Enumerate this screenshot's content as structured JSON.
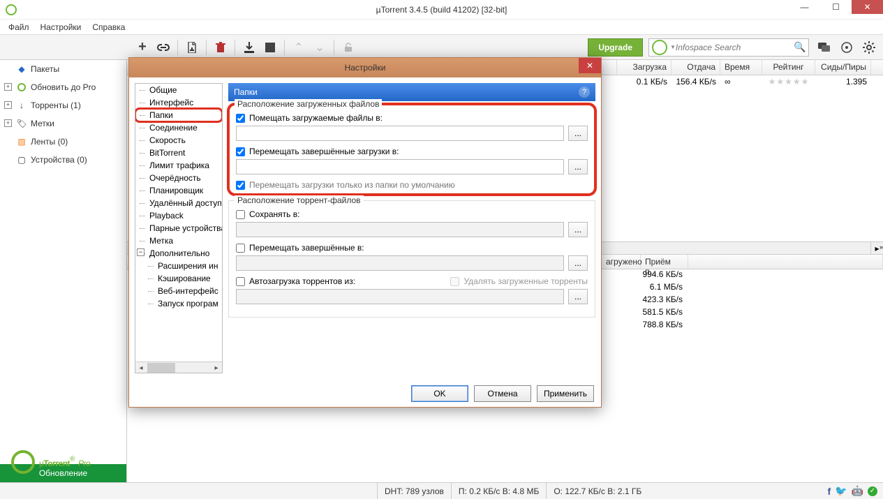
{
  "window": {
    "title": "µTorrent 3.4.5  (build 41202) [32-bit]"
  },
  "menu": {
    "file": "Файл",
    "settings": "Настройки",
    "help": "Справка"
  },
  "toolbar": {
    "upgrade": "Upgrade",
    "search_placeholder": "Infospace Search"
  },
  "sidebar": {
    "packets": "Пакеты",
    "upgrade_pro": "Обновить до Pro",
    "torrents": "Торренты (1)",
    "labels": "Метки",
    "feeds": "Ленты (0)",
    "devices": "Устройства (0)",
    "update": "Обновление"
  },
  "grid": {
    "headers": {
      "download": "Загрузка",
      "upload": "Отдача",
      "time": "Время",
      "rating": "Рейтинг",
      "seeds_peers": "Сиды/Пиры"
    },
    "row": {
      "download": "0.1 КБ/s",
      "upload": "156.4 КБ/s",
      "time": "∞",
      "seeds_peers": "1.395"
    }
  },
  "detail": {
    "col_loaded": "агружено",
    "col_recv": "Приём п...",
    "rows": [
      "994.6 КБ/s",
      "6.1 МБ/s",
      "423.3 КБ/s",
      "581.5 КБ/s",
      "788.8 КБ/s"
    ]
  },
  "logo": {
    "text_pre": "µ",
    "text_main": "Torrent",
    "text_suffix": "Pro"
  },
  "status": {
    "dht": "DHT: 789 узлов",
    "down": "П: 0.2 КБ/с В: 4.8 МБ",
    "up": "О: 122.7 КБ/с В: 2.1 ГБ"
  },
  "dialog": {
    "title": "Настройки",
    "tree": [
      "Общие",
      "Интерфейс",
      "Папки",
      "Соединение",
      "Скорость",
      "BitTorrent",
      "Лимит трафика",
      "Очерёдность",
      "Планировщик",
      "Удалённый доступ",
      "Playback",
      "Парные устройства",
      "Метка",
      "Дополнительно"
    ],
    "tree_sub": [
      "Расширения ин",
      "Кэширование",
      "Веб-интерфейс",
      "Запуск програм"
    ],
    "section": "Папки",
    "group1_legend": "Расположение загруженных файлов",
    "chk_put_downloading": "Помещать загружаемые файлы в:",
    "chk_move_completed": "Перемещать завершённые загрузки в:",
    "chk_move_only_default": "Перемещать загрузки только из папки по умолчанию",
    "group2_legend": "Расположение торрент-файлов",
    "chk_save_in": "Сохранять в:",
    "chk_move_completed2": "Перемещать завершённые в:",
    "chk_autoload": "Автозагрузка торрентов из:",
    "chk_delete_loaded": "Удалять загруженные торренты",
    "browse": "...",
    "ok": "OK",
    "cancel": "Отмена",
    "apply": "Применить"
  }
}
